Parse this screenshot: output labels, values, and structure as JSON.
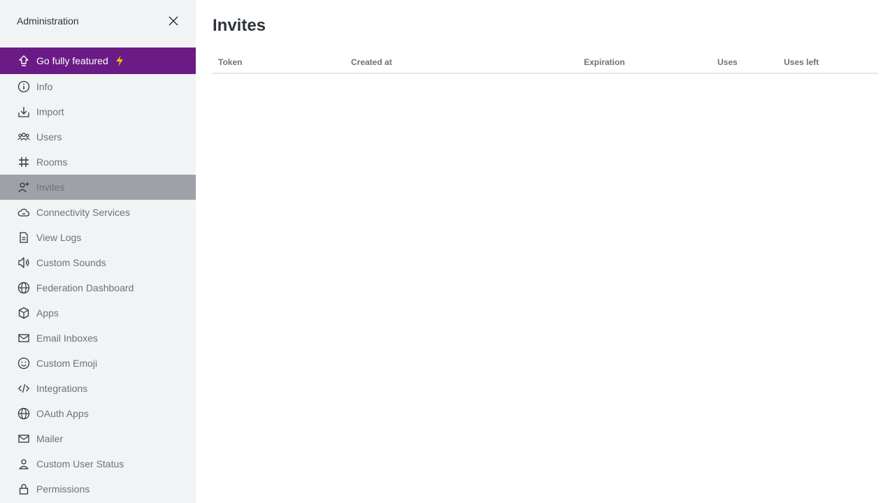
{
  "sidebar": {
    "title": "Administration",
    "promo": {
      "label": "Go fully featured",
      "icon": "arrow-up-icon",
      "badge_icon": "lightning-icon",
      "bg": "#6a1b86",
      "bolt_color": "#f3be08"
    },
    "items": [
      {
        "label": "Info",
        "icon": "info-icon"
      },
      {
        "label": "Import",
        "icon": "import-icon"
      },
      {
        "label": "Users",
        "icon": "users-icon"
      },
      {
        "label": "Rooms",
        "icon": "hashtag-icon"
      },
      {
        "label": "Invites",
        "icon": "user-plus-icon",
        "active": true
      },
      {
        "label": "Connectivity Services",
        "icon": "cloud-icon"
      },
      {
        "label": "View Logs",
        "icon": "document-icon"
      },
      {
        "label": "Custom Sounds",
        "icon": "speaker-icon"
      },
      {
        "label": "Federation Dashboard",
        "icon": "globe-icon"
      },
      {
        "label": "Apps",
        "icon": "cube-icon"
      },
      {
        "label": "Email Inboxes",
        "icon": "mail-icon"
      },
      {
        "label": "Custom Emoji",
        "icon": "emoji-icon"
      },
      {
        "label": "Integrations",
        "icon": "code-icon"
      },
      {
        "label": "OAuth Apps",
        "icon": "globe-icon"
      },
      {
        "label": "Mailer",
        "icon": "mail-icon"
      },
      {
        "label": "Custom User Status",
        "icon": "user-icon"
      },
      {
        "label": "Permissions",
        "icon": "lock-icon"
      }
    ]
  },
  "main": {
    "title": "Invites",
    "table": {
      "columns": [
        "Token",
        "Created at",
        "Expiration",
        "Uses",
        "Uses left"
      ],
      "rows": []
    }
  }
}
